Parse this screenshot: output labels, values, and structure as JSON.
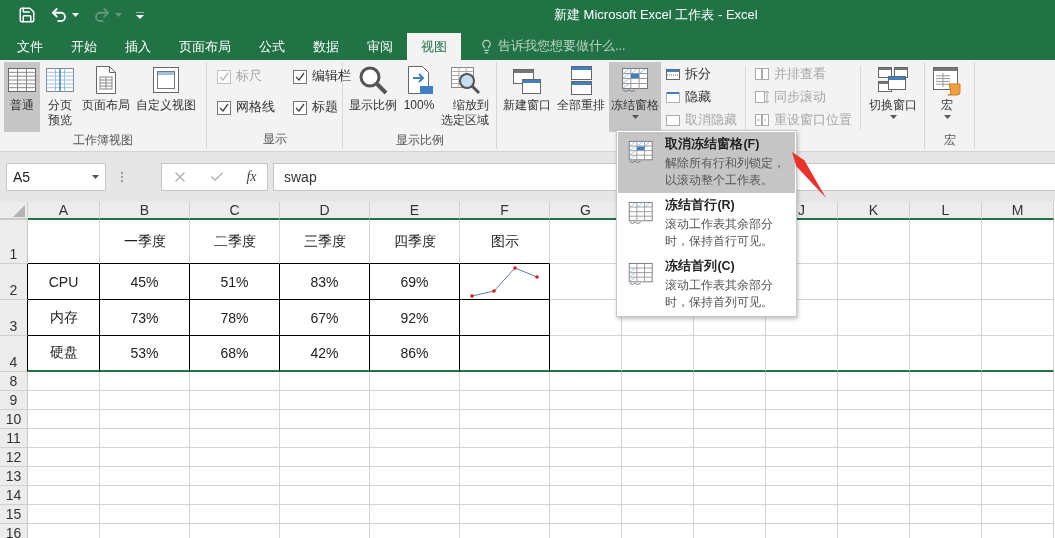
{
  "title_bar": {
    "title": "新建 Microsoft Excel 工作表 - Excel"
  },
  "tabs": [
    {
      "label": "文件",
      "selected": false
    },
    {
      "label": "开始",
      "selected": false
    },
    {
      "label": "插入",
      "selected": false
    },
    {
      "label": "页面布局",
      "selected": false
    },
    {
      "label": "公式",
      "selected": false
    },
    {
      "label": "数据",
      "selected": false
    },
    {
      "label": "审阅",
      "selected": false
    },
    {
      "label": "视图",
      "selected": true
    }
  ],
  "tell_me": {
    "placeholder": "告诉我您想要做什么..."
  },
  "ribbon": {
    "groups": [
      {
        "label": "工作簿视图",
        "items": [
          {
            "kind": "large",
            "label": "普通",
            "selected": true,
            "dropdown": false
          },
          {
            "kind": "large",
            "label": "分页预览",
            "selected": false,
            "dropdown": false
          },
          {
            "kind": "large",
            "label": "页面布局",
            "selected": false,
            "dropdown": false
          },
          {
            "kind": "large",
            "label": "自定义视图",
            "selected": false,
            "dropdown": false
          }
        ]
      },
      {
        "label": "显示",
        "items": [
          {
            "kind": "checkbox",
            "label": "标尺",
            "checked": true,
            "disabled": true
          },
          {
            "kind": "checkbox",
            "label": "编辑栏",
            "checked": true,
            "disabled": false
          },
          {
            "kind": "checkbox",
            "label": "网格线",
            "checked": true,
            "disabled": false
          },
          {
            "kind": "checkbox",
            "label": "标题",
            "checked": true,
            "disabled": false
          }
        ]
      },
      {
        "label": "显示比例",
        "items": [
          {
            "kind": "large",
            "label": "显示比例",
            "selected": false,
            "dropdown": false
          },
          {
            "kind": "large",
            "label": "100%",
            "selected": false,
            "dropdown": false
          },
          {
            "kind": "large",
            "label": "缩放到选定区域",
            "selected": false,
            "dropdown": false
          }
        ]
      },
      {
        "items": [
          {
            "kind": "large",
            "label": "新建窗口",
            "selected": false,
            "dropdown": false
          },
          {
            "kind": "large",
            "label": "全部重排",
            "selected": false,
            "dropdown": false
          },
          {
            "kind": "large",
            "label": "冻结窗格",
            "selected": true,
            "dropdown": true
          },
          {
            "kind": "stack",
            "items": [
              {
                "label": "拆分",
                "disabled": false
              },
              {
                "label": "隐藏",
                "disabled": false
              },
              {
                "label": "取消隐藏",
                "disabled": true
              }
            ]
          },
          {
            "kind": "stack",
            "items": [
              {
                "label": "并排查看",
                "disabled": true
              },
              {
                "label": "同步滚动",
                "disabled": true
              },
              {
                "label": "重设窗口位置",
                "disabled": true
              }
            ]
          },
          {
            "kind": "large",
            "label": "切换窗口",
            "selected": false,
            "dropdown": true
          }
        ]
      },
      {
        "label": "宏",
        "items": [
          {
            "kind": "large",
            "label": "宏",
            "selected": false,
            "dropdown": true
          }
        ]
      }
    ]
  },
  "formula_bar": {
    "name_box": "A5",
    "function_label": "fx",
    "value": "swap"
  },
  "sheet": {
    "column_headers": [
      "A",
      "B",
      "C",
      "D",
      "E",
      "F",
      "G"
    ],
    "column_headers_right": [
      "J",
      "K",
      "L",
      "M"
    ],
    "rows": [
      {
        "number": "1",
        "bordered": false,
        "freeze_line": false,
        "cells": [
          {
            "kind": "empty"
          },
          {
            "kind": "text",
            "text": "一季度"
          },
          {
            "kind": "text",
            "text": "二季度"
          },
          {
            "kind": "text",
            "text": "三季度"
          },
          {
            "kind": "text",
            "text": "四季度"
          },
          {
            "kind": "text",
            "text": "图示"
          }
        ]
      },
      {
        "number": "2",
        "bordered": true,
        "freeze_line": false,
        "cells": [
          {
            "kind": "text",
            "text": "CPU"
          },
          {
            "kind": "text",
            "text": "45%"
          },
          {
            "kind": "text",
            "text": "51%"
          },
          {
            "kind": "text",
            "text": "83%"
          },
          {
            "kind": "text",
            "text": "69%"
          },
          {
            "kind": "sparkline"
          }
        ]
      },
      {
        "number": "3",
        "bordered": true,
        "freeze_line": false,
        "cells": [
          {
            "kind": "text",
            "text": "内存"
          },
          {
            "kind": "text",
            "text": "73%"
          },
          {
            "kind": "text",
            "text": "78%"
          },
          {
            "kind": "text",
            "text": "67%"
          },
          {
            "kind": "text",
            "text": "92%"
          }
        ]
      },
      {
        "number": "4",
        "bordered": true,
        "freeze_line": true,
        "cells": [
          {
            "kind": "text",
            "text": "硬盘"
          },
          {
            "kind": "text",
            "text": "53%"
          },
          {
            "kind": "text",
            "text": "68%"
          },
          {
            "kind": "text",
            "text": "42%"
          },
          {
            "kind": "text",
            "text": "86%"
          }
        ]
      },
      {
        "number": "8",
        "bordered": false,
        "freeze_line": false
      },
      {
        "number": "9",
        "bordered": false,
        "freeze_line": false
      },
      {
        "number": "10",
        "bordered": false,
        "freeze_line": false
      },
      {
        "number": "11",
        "bordered": false,
        "freeze_line": false
      },
      {
        "number": "12",
        "bordered": false,
        "freeze_line": false
      },
      {
        "number": "13",
        "bordered": false,
        "freeze_line": false
      },
      {
        "number": "14",
        "bordered": false,
        "freeze_line": false
      },
      {
        "number": "15",
        "bordered": false,
        "freeze_line": false
      },
      {
        "number": "16",
        "bordered": false,
        "freeze_line": false
      }
    ]
  },
  "freeze_menu": {
    "items": [
      {
        "title": "取消冻结窗格(F)",
        "description": "解除所有行和列锁定，以滚动整个工作表。",
        "selected": true
      },
      {
        "title": "冻结首行(R)",
        "description": "滚动工作表其余部分时，保持首行可见。",
        "selected": false
      },
      {
        "title": "冻结首列(C)",
        "description": "滚动工作表其余部分时，保持首列可见。",
        "selected": false
      }
    ]
  }
}
